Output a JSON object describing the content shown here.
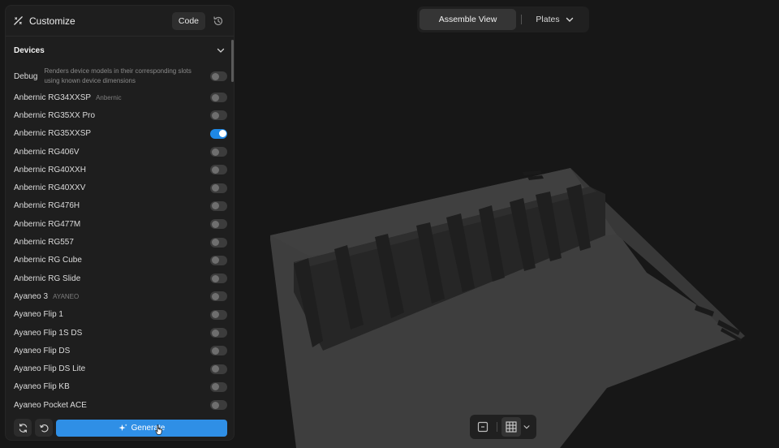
{
  "panel": {
    "title": "Customize",
    "code_label": "Code"
  },
  "section": {
    "title": "Devices"
  },
  "debug": {
    "label": "Debug",
    "description": "Renders device models in their corresponding slots using known device dimensions",
    "enabled": false
  },
  "devices": [
    {
      "label": "Anbernic RG34XXSP",
      "brand": "Anbernic",
      "enabled": false
    },
    {
      "label": "Anbernic RG35XX Pro",
      "brand": "",
      "enabled": false
    },
    {
      "label": "Anbernic RG35XXSP",
      "brand": "",
      "enabled": true
    },
    {
      "label": "Anbernic RG406V",
      "brand": "",
      "enabled": false
    },
    {
      "label": "Anbernic RG40XXH",
      "brand": "",
      "enabled": false
    },
    {
      "label": "Anbernic RG40XXV",
      "brand": "",
      "enabled": false
    },
    {
      "label": "Anbernic RG476H",
      "brand": "",
      "enabled": false
    },
    {
      "label": "Anbernic RG477M",
      "brand": "",
      "enabled": false
    },
    {
      "label": "Anbernic RG557",
      "brand": "",
      "enabled": false
    },
    {
      "label": "Anbernic RG Cube",
      "brand": "",
      "enabled": false
    },
    {
      "label": "Anbernic RG Slide",
      "brand": "",
      "enabled": false
    },
    {
      "label": "Ayaneo 3",
      "brand": "AYANEO",
      "enabled": false
    },
    {
      "label": "Ayaneo Flip 1",
      "brand": "",
      "enabled": false
    },
    {
      "label": "Ayaneo Flip 1S DS",
      "brand": "",
      "enabled": false
    },
    {
      "label": "Ayaneo Flip DS",
      "brand": "",
      "enabled": false
    },
    {
      "label": "Ayaneo Flip DS Lite",
      "brand": "",
      "enabled": false
    },
    {
      "label": "Ayaneo Flip KB",
      "brand": "",
      "enabled": false
    },
    {
      "label": "Ayaneo Pocket ACE",
      "brand": "",
      "enabled": false
    }
  ],
  "footer": {
    "generate_label": "Generate"
  },
  "view": {
    "assemble_label": "Assemble View",
    "plates_label": "Plates"
  },
  "colors": {
    "accent": "#2f8fe6",
    "toggle_on": "#1e88e5",
    "panel_bg": "#1e1e1e",
    "viewport_bg": "#171717"
  },
  "icons": {
    "customize": "customize-icon",
    "history": "history-icon",
    "refresh": "refresh-icon",
    "reset": "reset-icon",
    "sparkle": "sparkle-icon",
    "chevron": "chevron-down-icon",
    "frame": "frame-icon",
    "grid": "grid-icon"
  }
}
